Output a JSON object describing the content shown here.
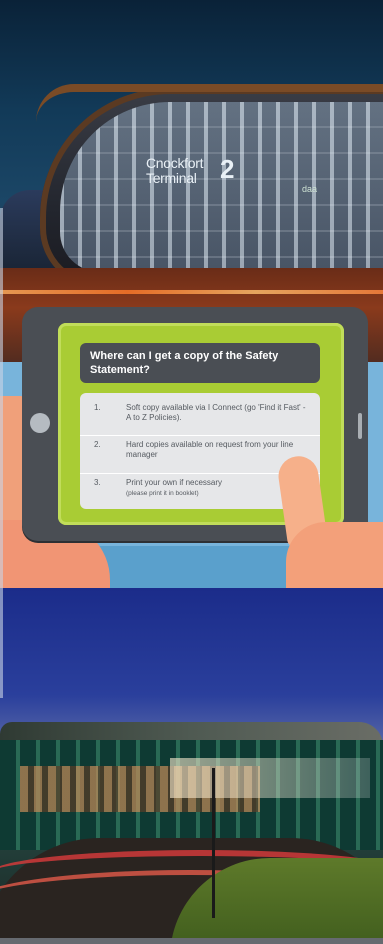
{
  "terminal_sign": {
    "line1": "Cnockfort",
    "line2": "Terminal",
    "number": "2",
    "logo": "daa"
  },
  "tablet": {
    "question": "Where can I get a copy of the Safety Statement?",
    "answers": [
      {
        "num": "1.",
        "text": "Soft copy available via I Connect (go 'Find it Fast' - A to Z Policies)."
      },
      {
        "num": "2.",
        "text": "Hard copies available on request from your line manager"
      },
      {
        "num": "3.",
        "text": "Print your own if necessary",
        "note": "(please print it in booklet)"
      }
    ]
  },
  "colors": {
    "tablet_frame": "#4a4e54",
    "screen_green": "#a9cc34",
    "sky_blue": "#78b4db",
    "skin": "#f0a07a"
  }
}
